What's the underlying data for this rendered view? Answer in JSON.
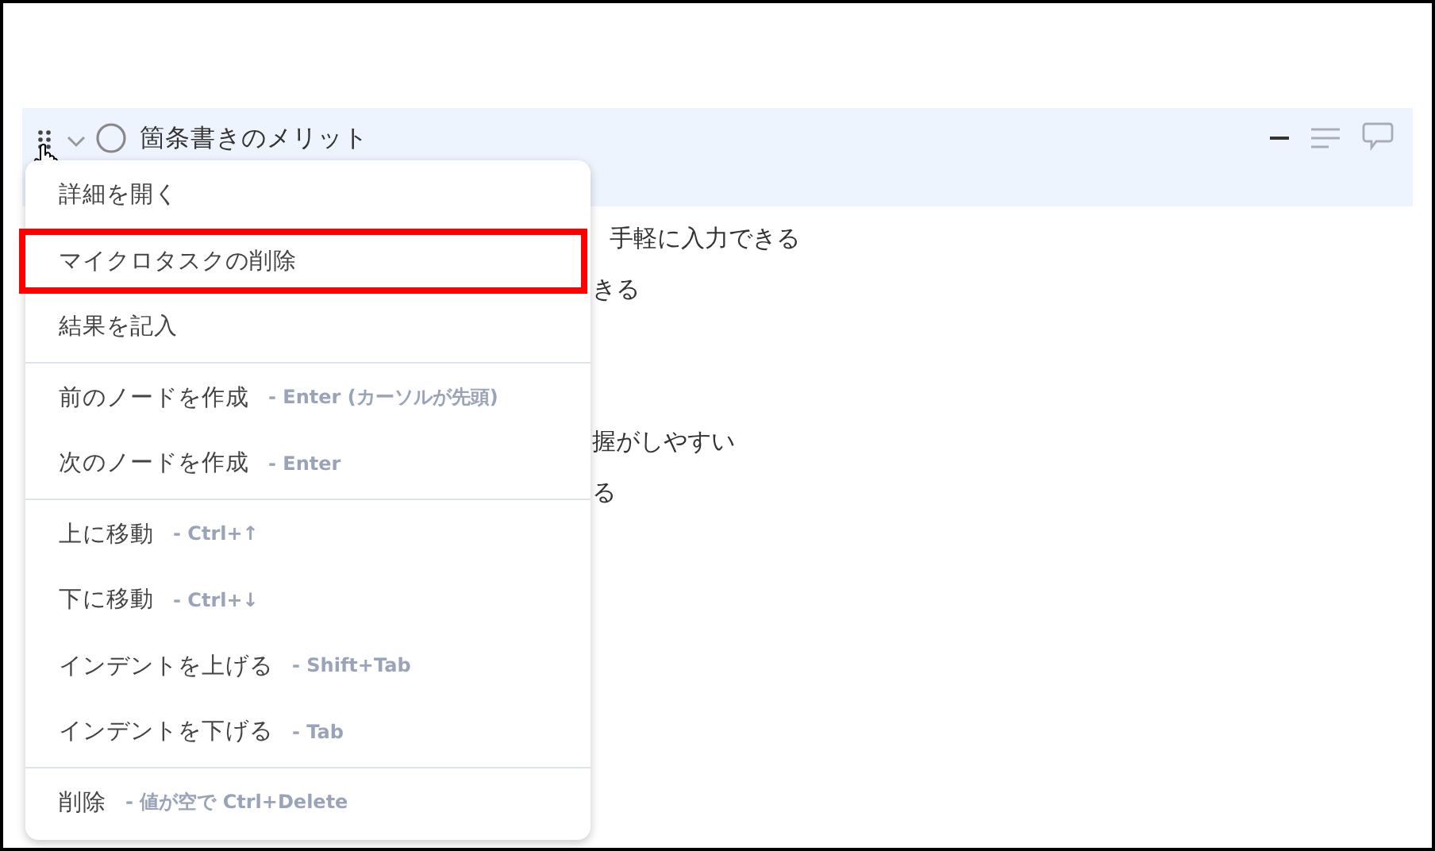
{
  "node": {
    "title": "箇条書きのメリット",
    "expanded": true
  },
  "children": [
    {
      "text": "手軽に入力できる",
      "kind": "full"
    },
    {
      "text": "きる",
      "kind": "clipped"
    },
    {
      "kind": "empty"
    },
    {
      "kind": "empty"
    },
    {
      "text": "握がしやすい",
      "kind": "clipped"
    },
    {
      "text": "る",
      "kind": "clipped"
    }
  ],
  "menu": {
    "groups": [
      [
        {
          "label": "詳細を開く",
          "highlighted": false
        },
        {
          "label": "マイクロタスクの削除",
          "highlighted": true
        },
        {
          "label": "結果を記入",
          "highlighted": false
        }
      ],
      [
        {
          "label": "前のノードを作成",
          "shortcut": "- Enter (カーソルが先頭)",
          "highlighted": false
        },
        {
          "label": "次のノードを作成",
          "shortcut": "- Enter",
          "highlighted": false
        }
      ],
      [
        {
          "label": "上に移動",
          "shortcut": "- Ctrl+↑",
          "highlighted": false
        },
        {
          "label": "下に移動",
          "shortcut": "- Ctrl+↓",
          "highlighted": false
        },
        {
          "label": "インデントを上げる",
          "shortcut": "- Shift+Tab",
          "highlighted": false
        },
        {
          "label": "インデントを下げる",
          "shortcut": "- Tab",
          "highlighted": false
        }
      ],
      [
        {
          "label": "削除",
          "shortcut": "- 値が空で Ctrl+Delete",
          "highlighted": false
        }
      ]
    ]
  }
}
